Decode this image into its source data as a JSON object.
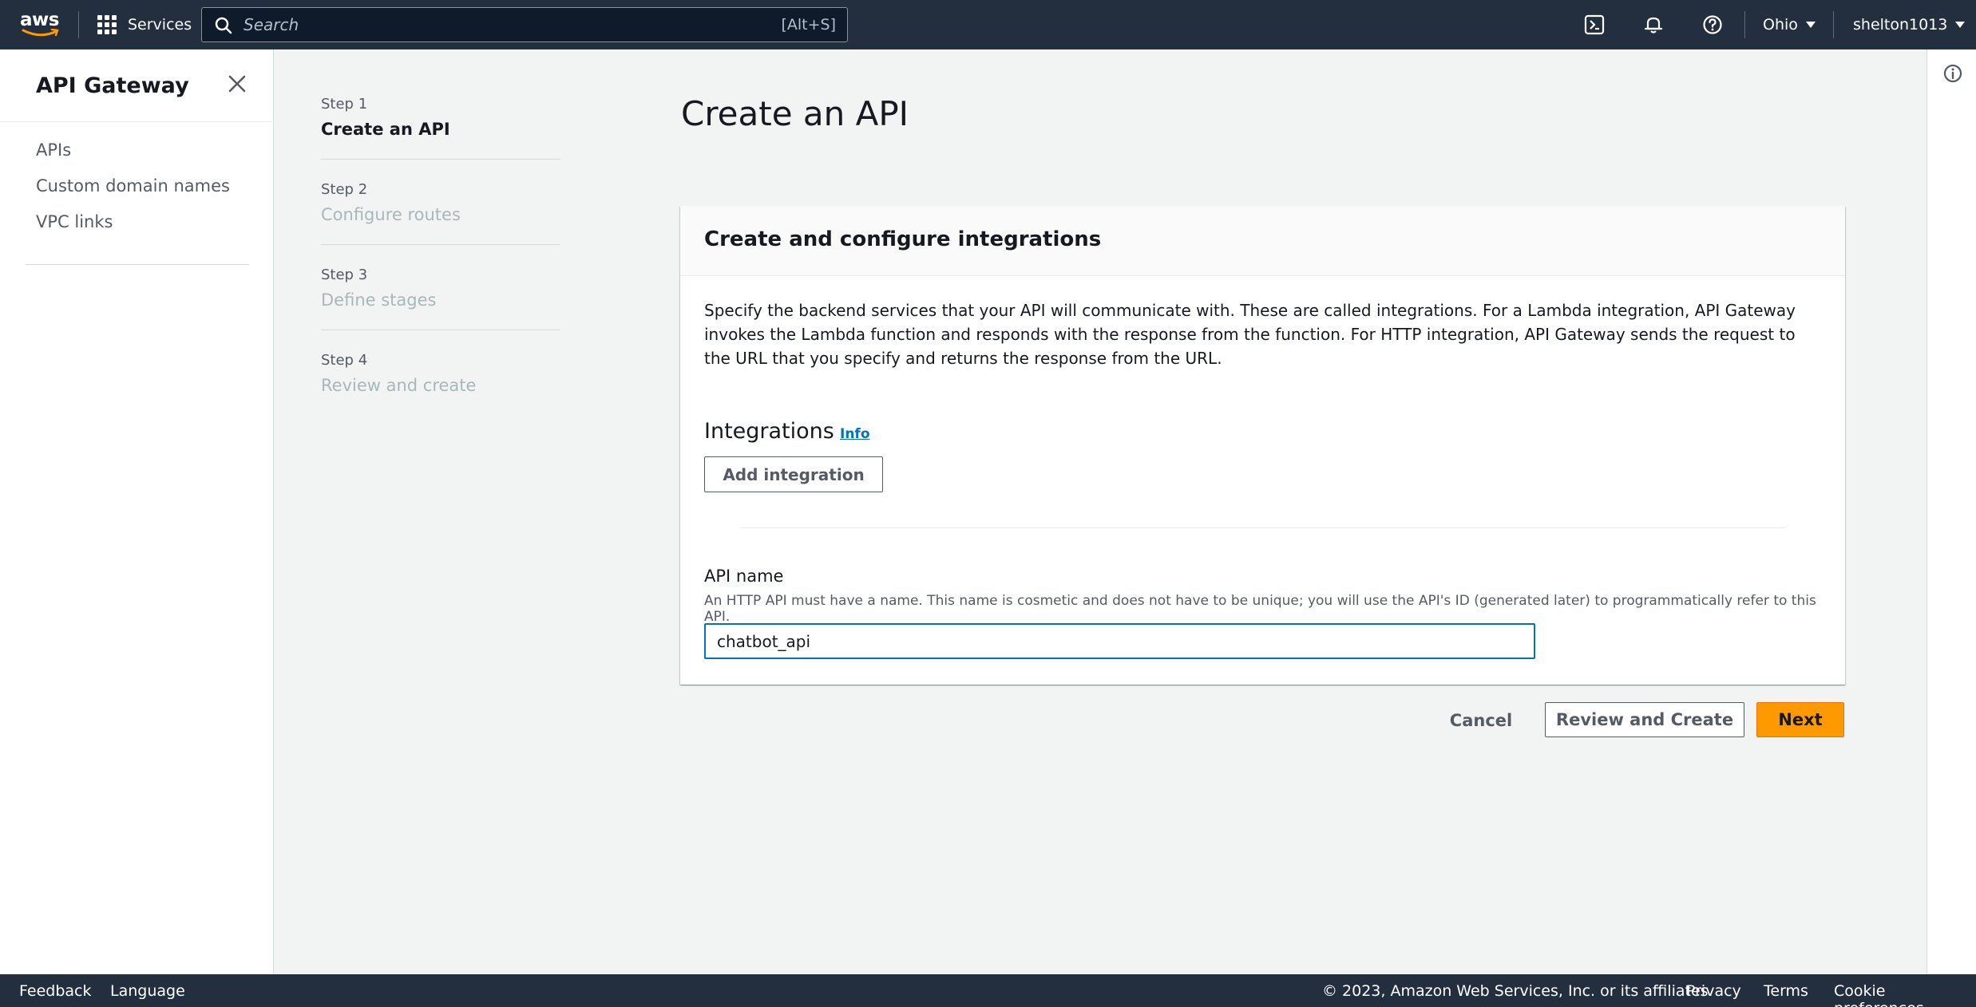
{
  "topnav": {
    "logo_text": "aws",
    "services_label": "Services",
    "search_placeholder": "Search",
    "search_hint": "[Alt+S]",
    "region": "Ohio",
    "account": "shelton1013",
    "icons": [
      "grid-icon",
      "search-icon",
      "cloudshell-icon",
      "bell-icon",
      "help-icon"
    ]
  },
  "sidebar": {
    "title": "API Gateway",
    "items": [
      "APIs",
      "Custom domain names",
      "VPC links"
    ]
  },
  "steps": [
    {
      "num": "Step 1",
      "name": "Create an API",
      "active": true
    },
    {
      "num": "Step 2",
      "name": "Configure routes",
      "active": false
    },
    {
      "num": "Step 3",
      "name": "Define stages",
      "active": false
    },
    {
      "num": "Step 4",
      "name": "Review and create",
      "active": false
    }
  ],
  "main": {
    "title": "Create an API",
    "panel": {
      "header": "Create and configure integrations",
      "description": "Specify the backend services that your API will communicate with. These are called integrations. For a Lambda integration, API Gateway invokes the Lambda function and responds with the response from the function. For HTTP integration, API Gateway sends the request to the URL that you specify and returns the response from the URL.",
      "integrations_title": "Integrations",
      "info_link": "Info",
      "add_integration_label": "Add integration",
      "api_name_label": "API name",
      "api_name_description": "An HTTP API must have a name. This name is cosmetic and does not have to be unique; you will use the API's ID (generated later) to programmatically refer to this API.",
      "api_name_value": "chatbot_api"
    },
    "actions": {
      "cancel": "Cancel",
      "review": "Review and Create",
      "next": "Next"
    }
  },
  "footer": {
    "feedback": "Feedback",
    "language": "Language",
    "copyright": "© 2023, Amazon Web Services, Inc. or its affiliates.",
    "privacy": "Privacy",
    "terms": "Terms",
    "cookies": "Cookie preferences"
  },
  "colors": {
    "nav_bg": "#232f3e",
    "primary_button": "#ff9900",
    "link": "#0073bb",
    "page_bg": "#f2f3f3"
  }
}
